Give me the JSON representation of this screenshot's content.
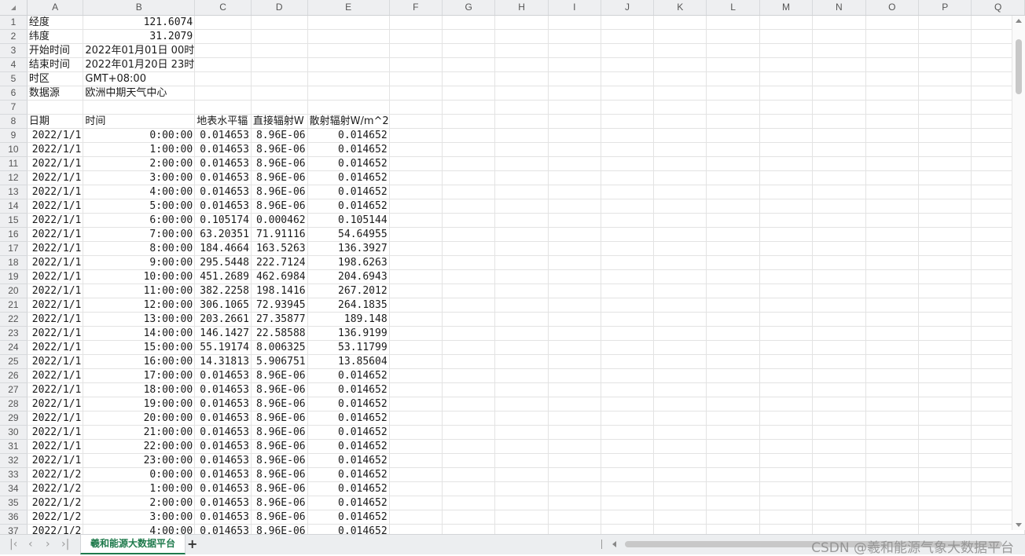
{
  "columns": [
    "A",
    "B",
    "C",
    "D",
    "E",
    "F",
    "G",
    "H",
    "I",
    "J",
    "K",
    "L",
    "M",
    "N",
    "O",
    "P",
    "Q"
  ],
  "meta_rows": [
    {
      "row": "1",
      "label": "经度",
      "value": "121.6074",
      "align": "num"
    },
    {
      "row": "2",
      "label": "纬度",
      "value": "31.2079",
      "align": "num"
    },
    {
      "row": "3",
      "label": "开始时间",
      "value": "2022年01月01日 00时",
      "align": "txt"
    },
    {
      "row": "4",
      "label": "结束时间",
      "value": "2022年01月20日 23时",
      "align": "txt"
    },
    {
      "row": "5",
      "label": "时区",
      "value": "GMT+08:00",
      "align": "txt"
    },
    {
      "row": "6",
      "label": "数据源",
      "value": "欧洲中期天气中心",
      "align": "txt"
    }
  ],
  "blank_row": "7",
  "header_row": {
    "row": "8",
    "cells": [
      "日期",
      "时间",
      "地表水平辐",
      "直接辐射W",
      "散射辐射W/m^2"
    ]
  },
  "data_rows": [
    [
      "9",
      "2022/1/1",
      "0:00:00",
      "0.014653",
      "8.96E-06",
      "0.014652"
    ],
    [
      "10",
      "2022/1/1",
      "1:00:00",
      "0.014653",
      "8.96E-06",
      "0.014652"
    ],
    [
      "11",
      "2022/1/1",
      "2:00:00",
      "0.014653",
      "8.96E-06",
      "0.014652"
    ],
    [
      "12",
      "2022/1/1",
      "3:00:00",
      "0.014653",
      "8.96E-06",
      "0.014652"
    ],
    [
      "13",
      "2022/1/1",
      "4:00:00",
      "0.014653",
      "8.96E-06",
      "0.014652"
    ],
    [
      "14",
      "2022/1/1",
      "5:00:00",
      "0.014653",
      "8.96E-06",
      "0.014652"
    ],
    [
      "15",
      "2022/1/1",
      "6:00:00",
      "0.105174",
      "0.000462",
      "0.105144"
    ],
    [
      "16",
      "2022/1/1",
      "7:00:00",
      "63.20351",
      "71.91116",
      "54.64955"
    ],
    [
      "17",
      "2022/1/1",
      "8:00:00",
      "184.4664",
      "163.5263",
      "136.3927"
    ],
    [
      "18",
      "2022/1/1",
      "9:00:00",
      "295.5448",
      "222.7124",
      "198.6263"
    ],
    [
      "19",
      "2022/1/1",
      "10:00:00",
      "451.2689",
      "462.6984",
      "204.6943"
    ],
    [
      "20",
      "2022/1/1",
      "11:00:00",
      "382.2258",
      "198.1416",
      "267.2012"
    ],
    [
      "21",
      "2022/1/1",
      "12:00:00",
      "306.1065",
      "72.93945",
      "264.1835"
    ],
    [
      "22",
      "2022/1/1",
      "13:00:00",
      "203.2661",
      "27.35877",
      "189.148"
    ],
    [
      "23",
      "2022/1/1",
      "14:00:00",
      "146.1427",
      "22.58588",
      "136.9199"
    ],
    [
      "24",
      "2022/1/1",
      "15:00:00",
      "55.19174",
      "8.006325",
      "53.11799"
    ],
    [
      "25",
      "2022/1/1",
      "16:00:00",
      "14.31813",
      "5.906751",
      "13.85604"
    ],
    [
      "26",
      "2022/1/1",
      "17:00:00",
      "0.014653",
      "8.96E-06",
      "0.014652"
    ],
    [
      "27",
      "2022/1/1",
      "18:00:00",
      "0.014653",
      "8.96E-06",
      "0.014652"
    ],
    [
      "28",
      "2022/1/1",
      "19:00:00",
      "0.014653",
      "8.96E-06",
      "0.014652"
    ],
    [
      "29",
      "2022/1/1",
      "20:00:00",
      "0.014653",
      "8.96E-06",
      "0.014652"
    ],
    [
      "30",
      "2022/1/1",
      "21:00:00",
      "0.014653",
      "8.96E-06",
      "0.014652"
    ],
    [
      "31",
      "2022/1/1",
      "22:00:00",
      "0.014653",
      "8.96E-06",
      "0.014652"
    ],
    [
      "32",
      "2022/1/1",
      "23:00:00",
      "0.014653",
      "8.96E-06",
      "0.014652"
    ],
    [
      "33",
      "2022/1/2",
      "0:00:00",
      "0.014653",
      "8.96E-06",
      "0.014652"
    ],
    [
      "34",
      "2022/1/2",
      "1:00:00",
      "0.014653",
      "8.96E-06",
      "0.014652"
    ],
    [
      "35",
      "2022/1/2",
      "2:00:00",
      "0.014653",
      "8.96E-06",
      "0.014652"
    ],
    [
      "36",
      "2022/1/2",
      "3:00:00",
      "0.014653",
      "8.96E-06",
      "0.014652"
    ],
    [
      "37",
      "2022/1/2",
      "4:00:00",
      "0.014653",
      "8.96E-06",
      "0.014652"
    ]
  ],
  "bottom_bar": {
    "nav_first": "|‹",
    "nav_prev": "‹",
    "nav_next": "›",
    "nav_last": "›|",
    "sheet_tab": "羲和能源大数据平台",
    "add_sheet": "+",
    "watermark": "CSDN @羲和能源气象大数据平台"
  }
}
